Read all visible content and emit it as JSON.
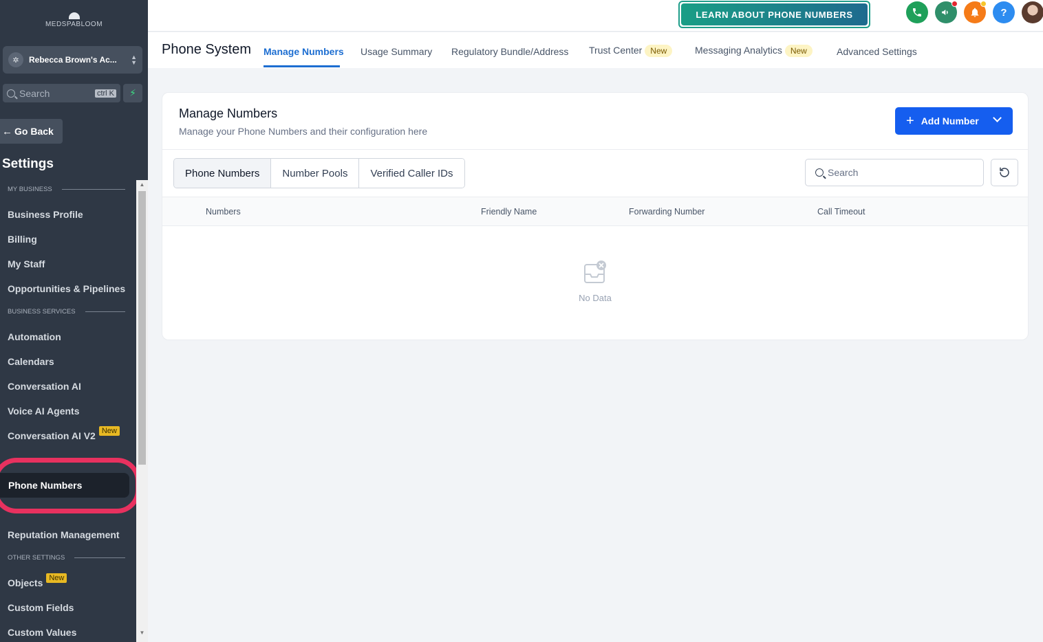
{
  "sidebar": {
    "logo": "MEDSPABLOOM",
    "account": "Rebecca Brown's Ac...",
    "search_placeholder": "Search",
    "search_shortcut": "ctrl K",
    "go_back": "Go Back",
    "settings_title": "Settings",
    "sections": {
      "my_business": "MY BUSINESS",
      "business_services": "BUSINESS SERVICES",
      "other_settings": "OTHER SETTINGS"
    },
    "items": {
      "business_profile": "Business Profile",
      "billing": "Billing",
      "my_staff": "My Staff",
      "opportunities": "Opportunities & Pipelines",
      "automation": "Automation",
      "calendars": "Calendars",
      "conversation_ai": "Conversation AI",
      "voice_ai": "Voice AI Agents",
      "conversation_ai_v2": "Conversation AI V2",
      "phone_numbers": "Phone Numbers",
      "reputation": "Reputation Management",
      "objects": "Objects",
      "custom_fields": "Custom Fields",
      "custom_values": "Custom Values"
    },
    "new_badge": "New"
  },
  "topbar": {
    "learn_button": "LEARN ABOUT PHONE NUMBERS",
    "help_glyph": "?",
    "colors": {
      "phone": "#1fa05a",
      "megaphone": "#2f8f6a",
      "bell": "#f57b18",
      "help": "#2d8cf0"
    }
  },
  "tabs": {
    "system_title": "Phone System",
    "manage_numbers": "Manage Numbers",
    "usage_summary": "Usage Summary",
    "regulatory": "Regulatory Bundle/Address",
    "trust_center": "Trust Center",
    "messaging_analytics": "Messaging Analytics",
    "advanced_settings": "Advanced Settings",
    "new_badge": "New"
  },
  "card": {
    "title": "Manage Numbers",
    "subtitle": "Manage your Phone Numbers and their configuration here",
    "add_button": "Add Number",
    "segments": [
      "Phone Numbers",
      "Number Pools",
      "Verified Caller IDs"
    ],
    "search_placeholder": "Search",
    "columns": [
      "Numbers",
      "Friendly Name",
      "Forwarding Number",
      "Call Timeout"
    ],
    "empty_text": "No Data"
  }
}
